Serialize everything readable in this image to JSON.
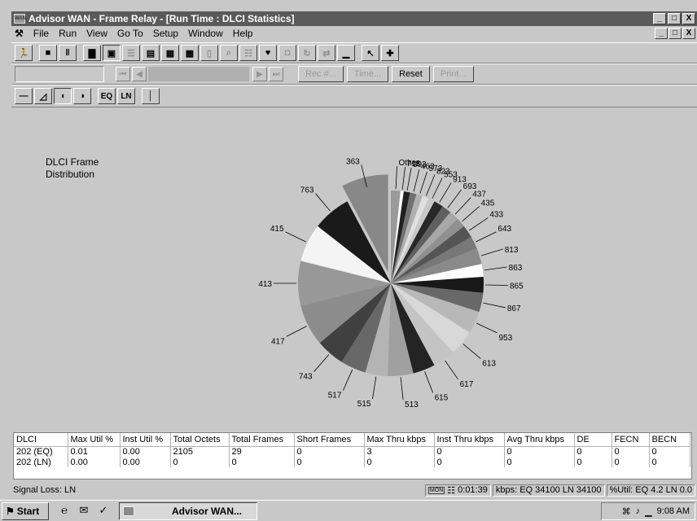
{
  "window": {
    "title": "Advisor WAN - Frame Relay - [Run Time : DLCI Statistics]",
    "controls": [
      "_",
      "□",
      "X"
    ]
  },
  "menu": {
    "items": [
      "File",
      "Run",
      "View",
      "Go To",
      "Setup",
      "Window",
      "Help"
    ]
  },
  "toolbar2": {
    "rec_label": "Rec #...",
    "time_label": "Time...",
    "reset_label": "Reset",
    "print_label": "Print..."
  },
  "toolbar3": {
    "eq_label": "EQ",
    "ln_label": "LN"
  },
  "chart_data": {
    "type": "pie",
    "title": "DLCI Frame\nDistribution",
    "title_lines": [
      "DLCI Frame",
      "Distribution"
    ],
    "exploded": "363",
    "slices": [
      {
        "label": "Other",
        "value": 1.5,
        "color": "#9a9a9a"
      },
      {
        "label": "713",
        "value": 0.5,
        "color": "#ffffff"
      },
      {
        "label": "393",
        "value": 1.0,
        "color": "#202020"
      },
      {
        "label": "463",
        "value": 1.0,
        "color": "#707070"
      },
      {
        "label": "573",
        "value": 1.0,
        "color": "#b0b0b0"
      },
      {
        "label": "823",
        "value": 1.0,
        "color": "#e0e0e0"
      },
      {
        "label": "553",
        "value": 1.0,
        "color": "#c8c8c8"
      },
      {
        "label": "913",
        "value": 1.5,
        "color": "#282828"
      },
      {
        "label": "693",
        "value": 1.5,
        "color": "#606060"
      },
      {
        "label": "437",
        "value": 1.5,
        "color": "#a8a8a8"
      },
      {
        "label": "435",
        "value": 1.5,
        "color": "#909090"
      },
      {
        "label": "433",
        "value": 2.0,
        "color": "#555555"
      },
      {
        "label": "643",
        "value": 2.0,
        "color": "#787878"
      },
      {
        "label": "813",
        "value": 2.5,
        "color": "#8a8a8a"
      },
      {
        "label": "863",
        "value": 2.0,
        "color": "#ffffff"
      },
      {
        "label": "865",
        "value": 2.5,
        "color": "#181818"
      },
      {
        "label": "867",
        "value": 3.0,
        "color": "#686868"
      },
      {
        "label": "953",
        "value": 3.5,
        "color": "#b8b8b8"
      },
      {
        "label": "613",
        "value": 4.0,
        "color": "#d8d8d8"
      },
      {
        "label": "617",
        "value": 3.5,
        "color": "#c4c4c4"
      },
      {
        "label": "615",
        "value": 3.5,
        "color": "#242424"
      },
      {
        "label": "513",
        "value": 4.0,
        "color": "#a0a0a0"
      },
      {
        "label": "515",
        "value": 3.5,
        "color": "#b4b4b4"
      },
      {
        "label": "517",
        "value": 4.0,
        "color": "#686868"
      },
      {
        "label": "743",
        "value": 4.5,
        "color": "#404040"
      },
      {
        "label": "417",
        "value": 6.5,
        "color": "#8c8c8c"
      },
      {
        "label": "413",
        "value": 7.0,
        "color": "#989898"
      },
      {
        "label": "415",
        "value": 6.0,
        "color": "#f4f4f4"
      },
      {
        "label": "763",
        "value": 6.0,
        "color": "#1a1a1a"
      },
      {
        "label": "363",
        "value": 7.0,
        "color": "#888888"
      }
    ]
  },
  "table": {
    "headers": [
      "DLCI",
      "Max Util %",
      "Inst Util %",
      "Total Octets",
      "Total Frames",
      "Short Frames",
      "Max Thru kbps",
      "Inst Thru kbps",
      "Avg Thru kbps",
      "DE",
      "FECN",
      "BECN"
    ],
    "rows": [
      [
        "202 (EQ)",
        "0.01",
        "0.00",
        "2105",
        "29",
        "0",
        "3",
        "0",
        "0",
        "0",
        "0",
        "0"
      ],
      [
        "202 (LN)",
        "0.00",
        "0.00",
        "0",
        "0",
        "0",
        "0",
        "0",
        "0",
        "0",
        "0",
        "0"
      ]
    ]
  },
  "status": {
    "signal": "Signal Loss: LN",
    "mon": "MON",
    "elapsed": "0:01:39",
    "kbps": "kbps: EQ 34100  LN 34100",
    "util": "%Util: EQ 4.2  LN 0.0"
  },
  "taskbar": {
    "start_label": "Start",
    "task_label": "Advisor WAN...",
    "clock": "9:08 AM"
  }
}
